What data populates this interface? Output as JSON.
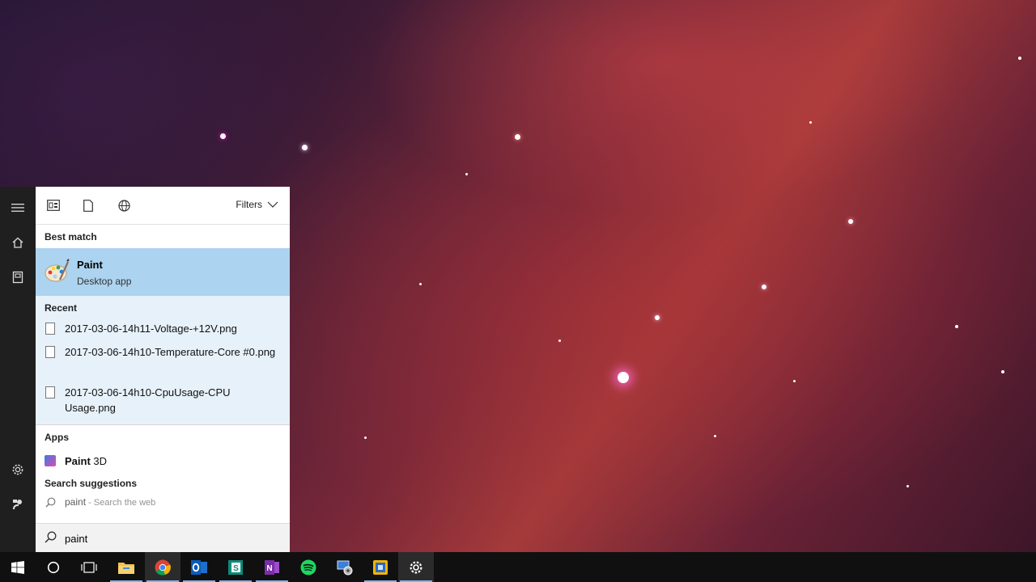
{
  "filters_bar": {
    "tabs": [
      {
        "icon": "apps-filter-icon"
      },
      {
        "icon": "documents-filter-icon"
      },
      {
        "icon": "web-filter-icon"
      }
    ],
    "filters_label": "Filters"
  },
  "best_match": {
    "header": "Best match",
    "title": "Paint",
    "subtitle": "Desktop app",
    "icon": "paint-palette-icon"
  },
  "recent": {
    "header": "Recent",
    "items": [
      {
        "name": "2017-03-06-14h11-Voltage-+12V.png"
      },
      {
        "name": "2017-03-06-14h10-Temperature-Core #0.png"
      },
      {
        "name": "2017-03-06-14h10-CpuUsage-CPU Usage.png"
      }
    ]
  },
  "apps": {
    "header": "Apps",
    "items": [
      {
        "name_bold": "Paint",
        "name_rest": " 3D"
      }
    ]
  },
  "suggestions": {
    "header": "Search suggestions",
    "items": [
      {
        "term": "paint",
        "sub": " - Search the web"
      }
    ]
  },
  "search": {
    "value": "paint"
  },
  "start_rail": {
    "top_icons": [
      "hamburger-menu-icon",
      "home-icon",
      "notebook-icon"
    ],
    "bottom_icons": [
      "settings-icon",
      "feedback-icon"
    ]
  },
  "taskbar": {
    "items": [
      {
        "name": "start-button",
        "icon": "windows-logo-icon"
      },
      {
        "name": "cortana-button",
        "icon": "cortana-circle-icon"
      },
      {
        "name": "task-view-button",
        "icon": "task-view-icon"
      },
      {
        "name": "file-explorer",
        "icon": "folder-icon"
      },
      {
        "name": "chrome",
        "icon": "chrome-icon"
      },
      {
        "name": "outlook",
        "icon": "outlook-icon"
      },
      {
        "name": "sway",
        "icon": "sway-icon"
      },
      {
        "name": "onenote",
        "icon": "onenote-icon"
      },
      {
        "name": "spotify",
        "icon": "spotify-icon"
      },
      {
        "name": "remote-app",
        "icon": "remote-desktop-icon"
      },
      {
        "name": "virtualbox",
        "icon": "virtualbox-icon"
      },
      {
        "name": "settings",
        "icon": "taskbar-settings-icon"
      }
    ]
  },
  "colors": {
    "highlight": "#acd3ef",
    "recent_bg": "#e7f1fa",
    "rail_bg": "#1f1f1f",
    "taskbar_bg": "#101010",
    "active_indicator": "#7bb7e8"
  }
}
